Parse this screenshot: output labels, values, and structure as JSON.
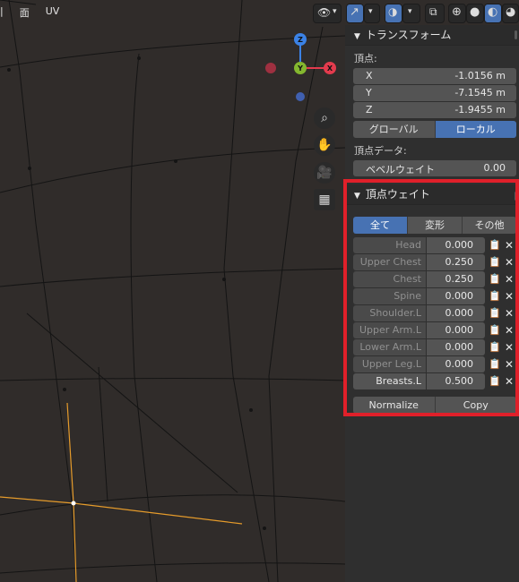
{
  "header_menu": [
    "面",
    "UV"
  ],
  "gizmo": {
    "x": "X",
    "y": "Y",
    "z": "Z"
  },
  "transform": {
    "title": "トランスフォーム",
    "vertex_label": "頂点:",
    "x_label": "X",
    "x_value": "-1.0156 m",
    "y_label": "Y",
    "y_value": "-7.1545 m",
    "z_label": "Z",
    "z_value": "-1.9455 m",
    "global_btn": "グローバル",
    "local_btn": "ローカル",
    "vertex_data_label": "頂点データ:",
    "bevel_label": "ベベルウェイト",
    "bevel_value": "0.00"
  },
  "vertex_weights": {
    "title": "頂点ウェイト",
    "tabs": [
      "全て",
      "変形",
      "その他"
    ],
    "rows": [
      {
        "name": "Head",
        "value": "0.000"
      },
      {
        "name": "Upper Chest",
        "value": "0.250"
      },
      {
        "name": "Chest",
        "value": "0.250"
      },
      {
        "name": "Spine",
        "value": "0.000"
      },
      {
        "name": "Shoulder.L",
        "value": "0.000"
      },
      {
        "name": "Upper Arm.L",
        "value": "0.000"
      },
      {
        "name": "Lower Arm.L",
        "value": "0.000"
      },
      {
        "name": "Upper Leg.L",
        "value": "0.000"
      },
      {
        "name": "Breasts.L",
        "value": "0.500"
      }
    ],
    "normalize_btn": "Normalize",
    "copy_btn": "Copy"
  },
  "colors": {
    "accent": "#4772b3",
    "highlight": "#e0202a",
    "edge_selected": "#e59b2b"
  }
}
